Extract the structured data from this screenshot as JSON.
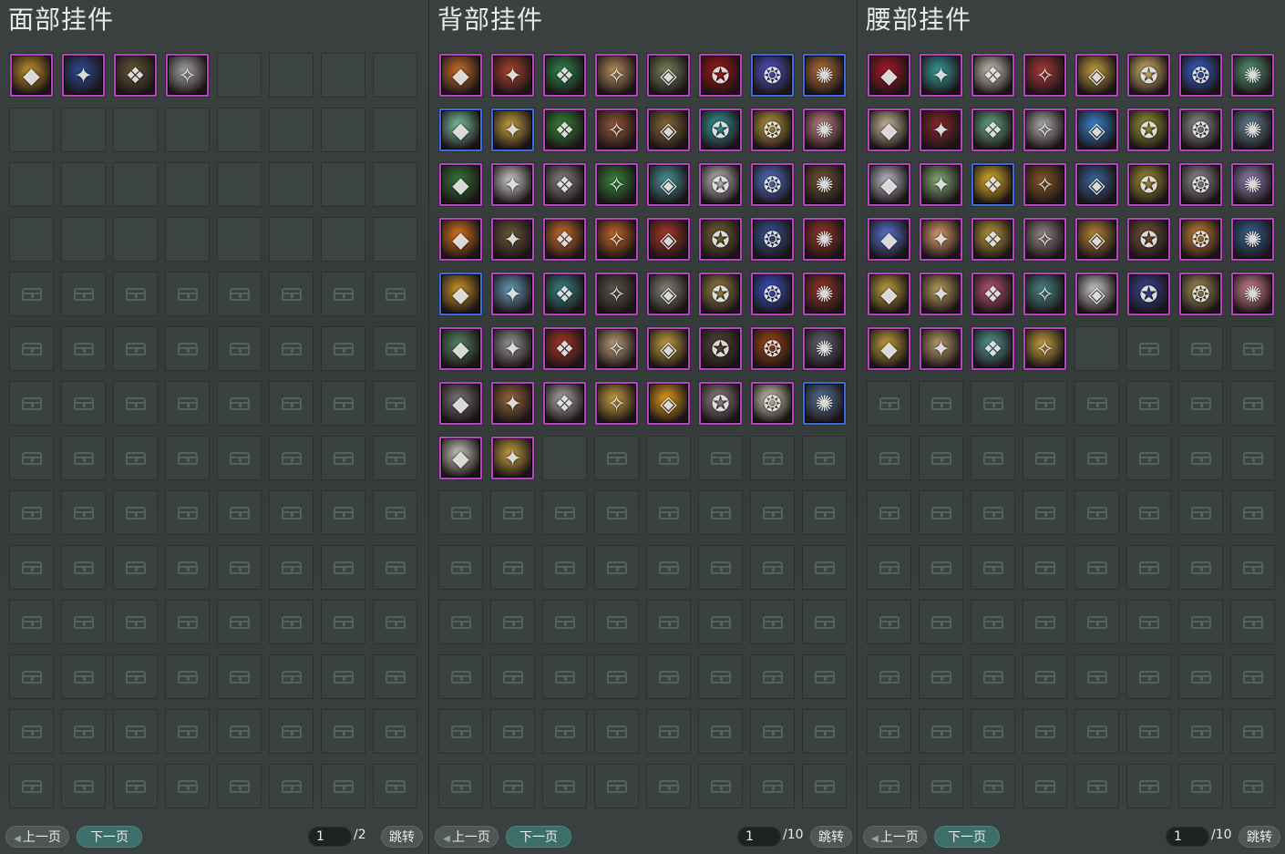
{
  "panels": [
    {
      "id": "face",
      "title": "面部挂件",
      "items": [
        {
          "icon": "golden-mask-icon",
          "color": "#c8962f",
          "border": "purple"
        },
        {
          "icon": "blue-mask-icon",
          "color": "#2f4f9a",
          "border": "purple"
        },
        {
          "icon": "dark-mask-icon",
          "color": "#6b5b3a",
          "border": "purple"
        },
        {
          "icon": "silver-shield-mask-icon",
          "color": "#a9a9a9",
          "border": "purple"
        }
      ],
      "unlocked_empty": 28,
      "locked": 80,
      "pager": {
        "prev": "上一页",
        "next": "下一页",
        "page": "1",
        "total": "/2",
        "jump": "跳转"
      }
    },
    {
      "id": "back",
      "title": "背部挂件",
      "items": [
        {
          "icon": "fire-orb-icon",
          "color": "#d0742a",
          "border": "purple"
        },
        {
          "icon": "red-creature-icon",
          "color": "#b0462f",
          "border": "purple"
        },
        {
          "icon": "green-spear-icon",
          "color": "#2f8f4f",
          "border": "purple"
        },
        {
          "icon": "fan-icon",
          "color": "#b8925c",
          "border": "purple"
        },
        {
          "icon": "scroll-icon",
          "color": "#7b8a5c",
          "border": "purple"
        },
        {
          "icon": "red-bow-icon",
          "color": "#b01818",
          "border": "purple"
        },
        {
          "icon": "lightning-icon",
          "color": "#5a5ad8",
          "border": "blue"
        },
        {
          "icon": "duck-icon",
          "color": "#c07a3a",
          "border": "blue"
        },
        {
          "icon": "jade-stone-icon",
          "color": "#7fc7a3",
          "border": "blue"
        },
        {
          "icon": "golden-scroll-icon",
          "color": "#c9a441",
          "border": "blue"
        },
        {
          "icon": "green-box-icon",
          "color": "#3b8a3b",
          "border": "purple"
        },
        {
          "icon": "kite-icon",
          "color": "#9a5a3a",
          "border": "purple"
        },
        {
          "icon": "triangle-flag-icon",
          "color": "#8b6d3b",
          "border": "purple"
        },
        {
          "icon": "teal-lute-icon",
          "color": "#3aa0a0",
          "border": "purple"
        },
        {
          "icon": "golden-staff-icon",
          "color": "#c9a441",
          "border": "purple"
        },
        {
          "icon": "doll-icon",
          "color": "#d08a8a",
          "border": "purple"
        },
        {
          "icon": "flower-wreath-icon",
          "color": "#3a7a3a",
          "border": "purple"
        },
        {
          "icon": "white-flower-icon",
          "color": "#d0d0d0",
          "border": "purple"
        },
        {
          "icon": "sword-icon",
          "color": "#8a8a8a",
          "border": "purple"
        },
        {
          "icon": "vine-icon",
          "color": "#3a8a3a",
          "border": "purple"
        },
        {
          "icon": "bird-icon",
          "color": "#4a9aa0",
          "border": "purple"
        },
        {
          "icon": "white-mask-icon",
          "color": "#c9c9c9",
          "border": "purple"
        },
        {
          "icon": "blue-disc-icon",
          "color": "#5a7ad8",
          "border": "purple"
        },
        {
          "icon": "tree-stump-icon",
          "color": "#7a5a3a",
          "border": "purple"
        },
        {
          "icon": "orange-orb-icon",
          "color": "#e07a1a",
          "border": "purple"
        },
        {
          "icon": "bamboo-hat-icon",
          "color": "#6b5b3a",
          "border": "purple"
        },
        {
          "icon": "gourd-icon",
          "color": "#d0742a",
          "border": "purple"
        },
        {
          "icon": "gourd-blue-icon",
          "color": "#c8682a",
          "border": "purple"
        },
        {
          "icon": "red-orb-icon",
          "color": "#b03a2a",
          "border": "purple"
        },
        {
          "icon": "straw-hat-icon",
          "color": "#7a6a3a",
          "border": "purple"
        },
        {
          "icon": "blue-sphere-icon",
          "color": "#3a5aa0",
          "border": "purple"
        },
        {
          "icon": "pavilion-icon",
          "color": "#a03a2a",
          "border": "purple"
        },
        {
          "icon": "golden-wing-icon",
          "color": "#d09a2a",
          "border": "blue"
        },
        {
          "icon": "blue-flower-icon",
          "color": "#6aa0c0",
          "border": "purple"
        },
        {
          "icon": "teal-pillar-icon",
          "color": "#3a8a8a",
          "border": "purple"
        },
        {
          "icon": "dark-blade-icon",
          "color": "#5a5a4a",
          "border": "purple"
        },
        {
          "icon": "wing-blade-icon",
          "color": "#8a8a7a",
          "border": "purple"
        },
        {
          "icon": "golden-bow-icon",
          "color": "#a08a4a",
          "border": "purple"
        },
        {
          "icon": "blue-spear-icon",
          "color": "#3a5ad8",
          "border": "purple"
        },
        {
          "icon": "red-tree-icon",
          "color": "#a03a2a",
          "border": "purple"
        },
        {
          "icon": "book-icon",
          "color": "#5a8a6a",
          "border": "purple"
        },
        {
          "icon": "feather-icon",
          "color": "#9a9a9a",
          "border": "purple"
        },
        {
          "icon": "red-wing-icon",
          "color": "#b03a2a",
          "border": "purple"
        },
        {
          "icon": "paper-fan-icon",
          "color": "#c0a07a",
          "border": "purple"
        },
        {
          "icon": "gold-wheel-icon",
          "color": "#c9a441",
          "border": "purple"
        },
        {
          "icon": "scythe-icon",
          "color": "#5a4a3a",
          "border": "purple"
        },
        {
          "icon": "treasure-chest-icon",
          "color": "#b04a1a",
          "border": "purple"
        },
        {
          "icon": "dark-sword-icon",
          "color": "#6a6a7a",
          "border": "purple"
        },
        {
          "icon": "chess-board-icon",
          "color": "#7a7a7a",
          "border": "purple"
        },
        {
          "icon": "monkey-icon",
          "color": "#9a6a3a",
          "border": "purple"
        },
        {
          "icon": "silver-ring-icon",
          "color": "#b0b0b0",
          "border": "purple"
        },
        {
          "icon": "golden-halberd-icon",
          "color": "#c9a441",
          "border": "purple"
        },
        {
          "icon": "flame-shard-icon",
          "color": "#e8a21a",
          "border": "purple"
        },
        {
          "icon": "silver-drum-icon",
          "color": "#9a8a8a",
          "border": "purple"
        },
        {
          "icon": "white-blossom-icon",
          "color": "#e0d8c0",
          "border": "purple"
        },
        {
          "icon": "blue-lantern-icon",
          "color": "#5a7aa0",
          "border": "blue"
        },
        {
          "icon": "white-peacock-icon",
          "color": "#d0d0c0",
          "border": "purple"
        },
        {
          "icon": "golden-dagger-icon",
          "color": "#c9a441",
          "border": "purple"
        }
      ],
      "unlocked_empty": 1,
      "locked": 53,
      "pager": {
        "prev": "上一页",
        "next": "下一页",
        "page": "1",
        "total": "/10",
        "jump": "跳转"
      }
    },
    {
      "id": "waist",
      "title": "腰部挂件",
      "items": [
        {
          "icon": "red-drum-icon",
          "color": "#b01a2a",
          "border": "purple"
        },
        {
          "icon": "teal-ring-icon",
          "color": "#3aa0a0",
          "border": "purple"
        },
        {
          "icon": "white-bird-icon",
          "color": "#d0d0c0",
          "border": "purple"
        },
        {
          "icon": "red-knot-icon",
          "color": "#b03a3a",
          "border": "purple"
        },
        {
          "icon": "golden-branch-icon",
          "color": "#c9a441",
          "border": "purple"
        },
        {
          "icon": "yellow-flower-icon",
          "color": "#e0c070",
          "border": "purple"
        },
        {
          "icon": "blue-jar-icon",
          "color": "#3a6ad8",
          "border": "purple"
        },
        {
          "icon": "jade-pendant-icon",
          "color": "#5aa080",
          "border": "purple"
        },
        {
          "icon": "white-tiger-icon",
          "color": "#d0c0a0",
          "border": "purple"
        },
        {
          "icon": "red-sword-icon",
          "color": "#8a2a2a",
          "border": "purple"
        },
        {
          "icon": "jade-dagger-icon",
          "color": "#6ab08a",
          "border": "purple"
        },
        {
          "icon": "silver-bells-icon",
          "color": "#b0b0b0",
          "border": "purple"
        },
        {
          "icon": "blue-medallion-icon",
          "color": "#3a8ad8",
          "border": "purple"
        },
        {
          "icon": "golden-wreath-icon",
          "color": "#a0a03a",
          "border": "purple"
        },
        {
          "icon": "silver-claw-icon",
          "color": "#9a9a9a",
          "border": "purple"
        },
        {
          "icon": "silver-disc-icon",
          "color": "#6a8aa0",
          "border": "purple"
        },
        {
          "icon": "white-flowers-icon",
          "color": "#c0c0d0",
          "border": "purple"
        },
        {
          "icon": "jade-bamboo-icon",
          "color": "#8ab07a",
          "border": "purple"
        },
        {
          "icon": "gold-ingot-icon",
          "color": "#e8b82a",
          "border": "blue"
        },
        {
          "icon": "wooden-idol-icon",
          "color": "#8a5a2a",
          "border": "purple"
        },
        {
          "icon": "blue-bottle-icon",
          "color": "#3a6aa0",
          "border": "purple"
        },
        {
          "icon": "golden-rod-icon",
          "color": "#b09a3a",
          "border": "purple"
        },
        {
          "icon": "silver-knot-icon",
          "color": "#9a9aa0",
          "border": "purple"
        },
        {
          "icon": "purple-ribbon-icon",
          "color": "#9a8ac0",
          "border": "purple"
        },
        {
          "icon": "blue-crystal-icon",
          "color": "#5a7ad8",
          "border": "purple"
        },
        {
          "icon": "bunny-icon",
          "color": "#e0a070",
          "border": "purple"
        },
        {
          "icon": "bird-cage-icon",
          "color": "#c0a040",
          "border": "purple"
        },
        {
          "icon": "silver-flute-icon",
          "color": "#9a8a8a",
          "border": "purple"
        },
        {
          "icon": "golden-flute-icon",
          "color": "#c08a3a",
          "border": "purple"
        },
        {
          "icon": "black-tassel-icon",
          "color": "#7a5a3a",
          "border": "purple"
        },
        {
          "icon": "orange-gourd-icon",
          "color": "#d08a3a",
          "border": "purple"
        },
        {
          "icon": "blue-armor-icon",
          "color": "#3a6aa0",
          "border": "purple"
        },
        {
          "icon": "golden-scepter-icon",
          "color": "#c9a441",
          "border": "purple"
        },
        {
          "icon": "spiral-shell-icon",
          "color": "#c0a060",
          "border": "purple"
        },
        {
          "icon": "pink-lantern-icon",
          "color": "#c05a7a",
          "border": "purple"
        },
        {
          "icon": "teal-gourd-icon",
          "color": "#4a8a8a",
          "border": "purple"
        },
        {
          "icon": "white-lily-icon",
          "color": "#d0d0d0",
          "border": "purple"
        },
        {
          "icon": "blue-vase-icon",
          "color": "#3a4aa0",
          "border": "purple"
        },
        {
          "icon": "golden-cat-icon",
          "color": "#b09a5a",
          "border": "purple"
        },
        {
          "icon": "pink-pig-icon",
          "color": "#e08a9a",
          "border": "purple"
        },
        {
          "icon": "golden-whip-icon",
          "color": "#c9a441",
          "border": "purple"
        },
        {
          "icon": "note-icon",
          "color": "#c0a070",
          "border": "purple"
        },
        {
          "icon": "teal-dragon-icon",
          "color": "#5aa0a0",
          "border": "purple"
        },
        {
          "icon": "golden-cabinet-icon",
          "color": "#c9a441",
          "border": "purple"
        }
      ],
      "unlocked_empty": 1,
      "locked": 67,
      "pager": {
        "prev": "上一页",
        "next": "下一页",
        "page": "1",
        "total": "/10",
        "jump": "跳转"
      }
    }
  ]
}
